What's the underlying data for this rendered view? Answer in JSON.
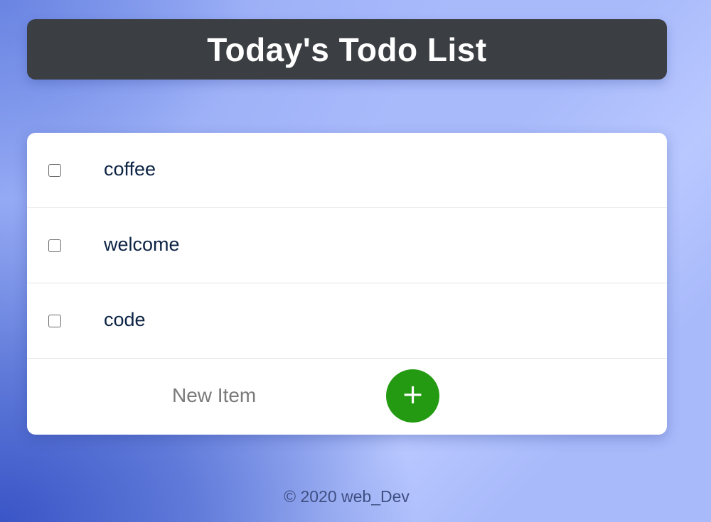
{
  "header": {
    "title": "Today's Todo List"
  },
  "todo": {
    "items": [
      {
        "label": "coffee",
        "checked": false
      },
      {
        "label": "welcome",
        "checked": false
      },
      {
        "label": "code",
        "checked": false
      }
    ],
    "new_item": {
      "placeholder": "New Item",
      "value": ""
    },
    "add_button": {
      "label": "+",
      "icon": "plus-icon"
    }
  },
  "footer": {
    "text": "© 2020 web_Dev"
  },
  "colors": {
    "header_bg": "#3b3e42",
    "add_button": "#249a12",
    "item_text": "#0c2344",
    "background_light": "#a9bafb",
    "background_dark": "#3a55c6"
  }
}
